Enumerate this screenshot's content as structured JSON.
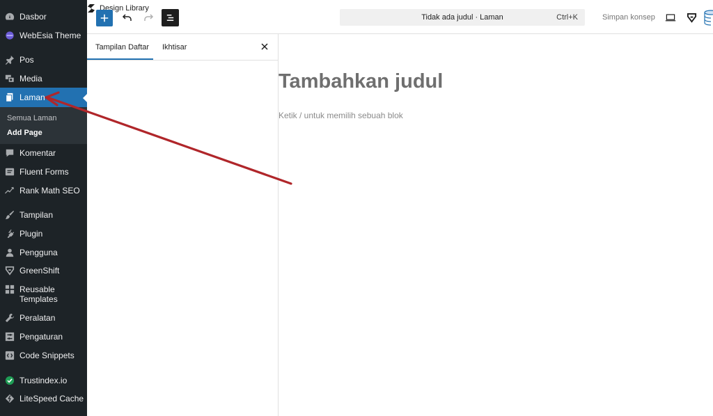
{
  "sidebar": {
    "items": [
      {
        "label": "Dasbor",
        "icon": "dashboard-icon"
      },
      {
        "label": "WebEsia Theme",
        "icon": "webesia-icon"
      },
      {
        "label": "Pos",
        "icon": "pin-icon"
      },
      {
        "label": "Media",
        "icon": "media-icon"
      },
      {
        "label": "Laman",
        "icon": "pages-icon"
      },
      {
        "label": "Komentar",
        "icon": "comment-icon"
      },
      {
        "label": "Fluent Forms",
        "icon": "forms-icon"
      },
      {
        "label": "Rank Math SEO",
        "icon": "rank-math-icon"
      },
      {
        "label": "Tampilan",
        "icon": "appearance-icon"
      },
      {
        "label": "Plugin",
        "icon": "plugin-icon"
      },
      {
        "label": "Pengguna",
        "icon": "users-icon"
      },
      {
        "label": "GreenShift",
        "icon": "greenshift-icon"
      },
      {
        "label": "Reusable",
        "label2": "Templates",
        "icon": "reusable-templates-icon"
      },
      {
        "label": "Peralatan",
        "icon": "tools-icon"
      },
      {
        "label": "Pengaturan",
        "icon": "settings-icon"
      },
      {
        "label": "Code Snippets",
        "icon": "code-icon"
      },
      {
        "label": "Trustindex.io",
        "icon": "trustindex-icon"
      },
      {
        "label": "LiteSpeed Cache",
        "icon": "litespeed-icon"
      }
    ],
    "submenu": [
      "Semua Laman",
      "Add Page"
    ]
  },
  "toolbar": {
    "design_library": "Design Library",
    "command_title": "Tidak ada judul · Laman",
    "shortcut": "Ctrl+K",
    "save_draft": "Simpan konsep"
  },
  "panel": {
    "tabs": [
      "Tampilan Daftar",
      "Ikhtisar"
    ]
  },
  "canvas": {
    "title_placeholder": "Tambahkan judul",
    "block_placeholder": "Ketik / untuk memilih sebuah blok"
  },
  "colors": {
    "sidebar_bg": "#1d2327",
    "active_blue": "#2271b1",
    "annotation_red": "#b0262a"
  }
}
